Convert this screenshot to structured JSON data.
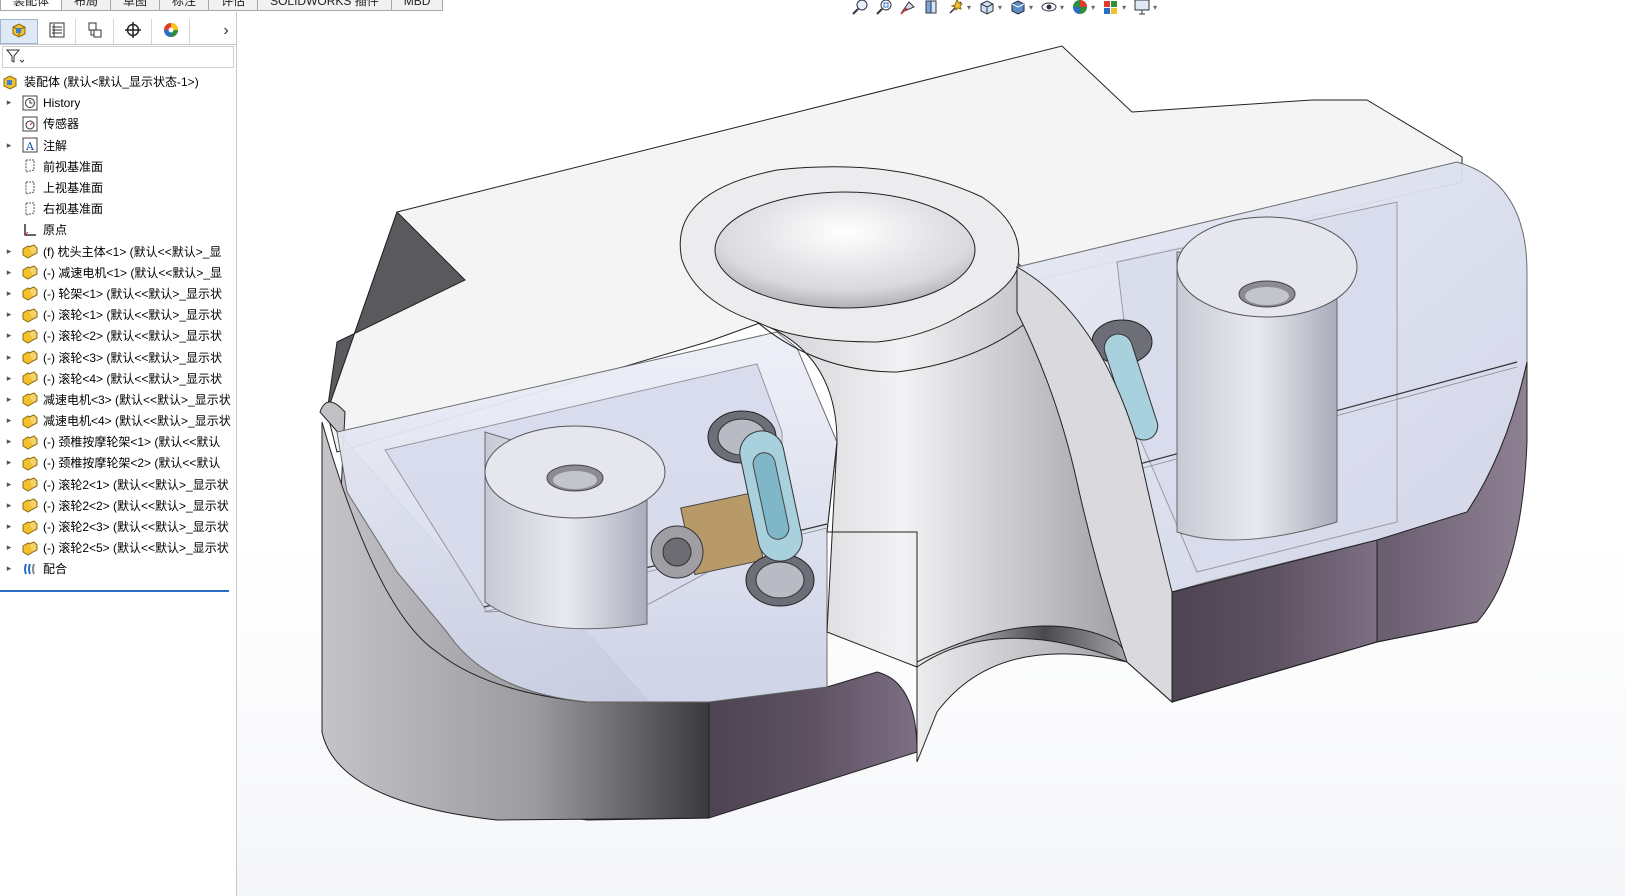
{
  "tabs": [
    "装配体",
    "布局",
    "草图",
    "标注",
    "评估",
    "SOLIDWORKS 插件",
    "MBD"
  ],
  "panel_tabs": [
    {
      "icon": "feature-manager-icon"
    },
    {
      "icon": "property-manager-icon"
    },
    {
      "icon": "configuration-manager-icon"
    },
    {
      "icon": "dimxpert-icon"
    },
    {
      "icon": "display-manager-icon"
    }
  ],
  "tree": {
    "root": "装配体  (默认<默认_显示状态-1>)",
    "items": [
      {
        "label": "History",
        "icon": "history-icon",
        "expander": true
      },
      {
        "label": "传感器",
        "icon": "sensor-icon",
        "expander": false
      },
      {
        "label": "注解",
        "icon": "annotation-icon",
        "expander": true
      },
      {
        "label": "前视基准面",
        "icon": "plane-icon",
        "expander": false
      },
      {
        "label": "上视基准面",
        "icon": "plane-icon",
        "expander": false
      },
      {
        "label": "右视基准面",
        "icon": "plane-icon",
        "expander": false
      },
      {
        "label": "原点",
        "icon": "origin-icon",
        "expander": false
      },
      {
        "label": "(f) 枕头主体<1> (默认<<默认>_显",
        "icon": "part-icon",
        "expander": true
      },
      {
        "label": "(-) 减速电机<1> (默认<<默认>_显",
        "icon": "part-icon",
        "expander": true
      },
      {
        "label": "(-) 轮架<1> (默认<<默认>_显示状",
        "icon": "part-icon",
        "expander": true
      },
      {
        "label": "(-) 滚轮<1> (默认<<默认>_显示状",
        "icon": "part-icon",
        "expander": true
      },
      {
        "label": "(-) 滚轮<2> (默认<<默认>_显示状",
        "icon": "part-icon",
        "expander": true
      },
      {
        "label": "(-) 滚轮<3> (默认<<默认>_显示状",
        "icon": "part-icon",
        "expander": true
      },
      {
        "label": "(-) 滚轮<4> (默认<<默认>_显示状",
        "icon": "part-icon",
        "expander": true
      },
      {
        "label": "减速电机<3> (默认<<默认>_显示状",
        "icon": "part-icon",
        "expander": true
      },
      {
        "label": "减速电机<4> (默认<<默认>_显示状",
        "icon": "part-icon",
        "expander": true
      },
      {
        "label": "(-) 颈椎按摩轮架<1> (默认<<默认",
        "icon": "part-icon",
        "expander": true
      },
      {
        "label": "(-) 颈椎按摩轮架<2> (默认<<默认",
        "icon": "part-icon",
        "expander": true
      },
      {
        "label": "(-) 滚轮2<1> (默认<<默认>_显示状",
        "icon": "part-icon",
        "expander": true
      },
      {
        "label": "(-) 滚轮2<2> (默认<<默认>_显示状",
        "icon": "part-icon",
        "expander": true
      },
      {
        "label": "(-) 滚轮2<3> (默认<<默认>_显示状",
        "icon": "part-icon",
        "expander": true
      },
      {
        "label": "(-) 滚轮2<5> (默认<<默认>_显示状",
        "icon": "part-icon",
        "expander": true
      },
      {
        "label": "配合",
        "icon": "mates-icon",
        "expander": true
      }
    ]
  },
  "hud": [
    "zoom-to-fit-icon",
    "zoom-to-area-icon",
    "previous-view-icon",
    "section-view-icon",
    "dynamic-annotation-icon",
    "view-orientation-icon",
    "display-style-icon",
    "hide-show-items-icon",
    "edit-appearance-icon",
    "apply-scene-icon",
    "view-settings-icon"
  ],
  "colors": {
    "selection": "#2a6fc7",
    "part_yellow": "#f2c12e",
    "panel_border": "#c9c9c9"
  }
}
